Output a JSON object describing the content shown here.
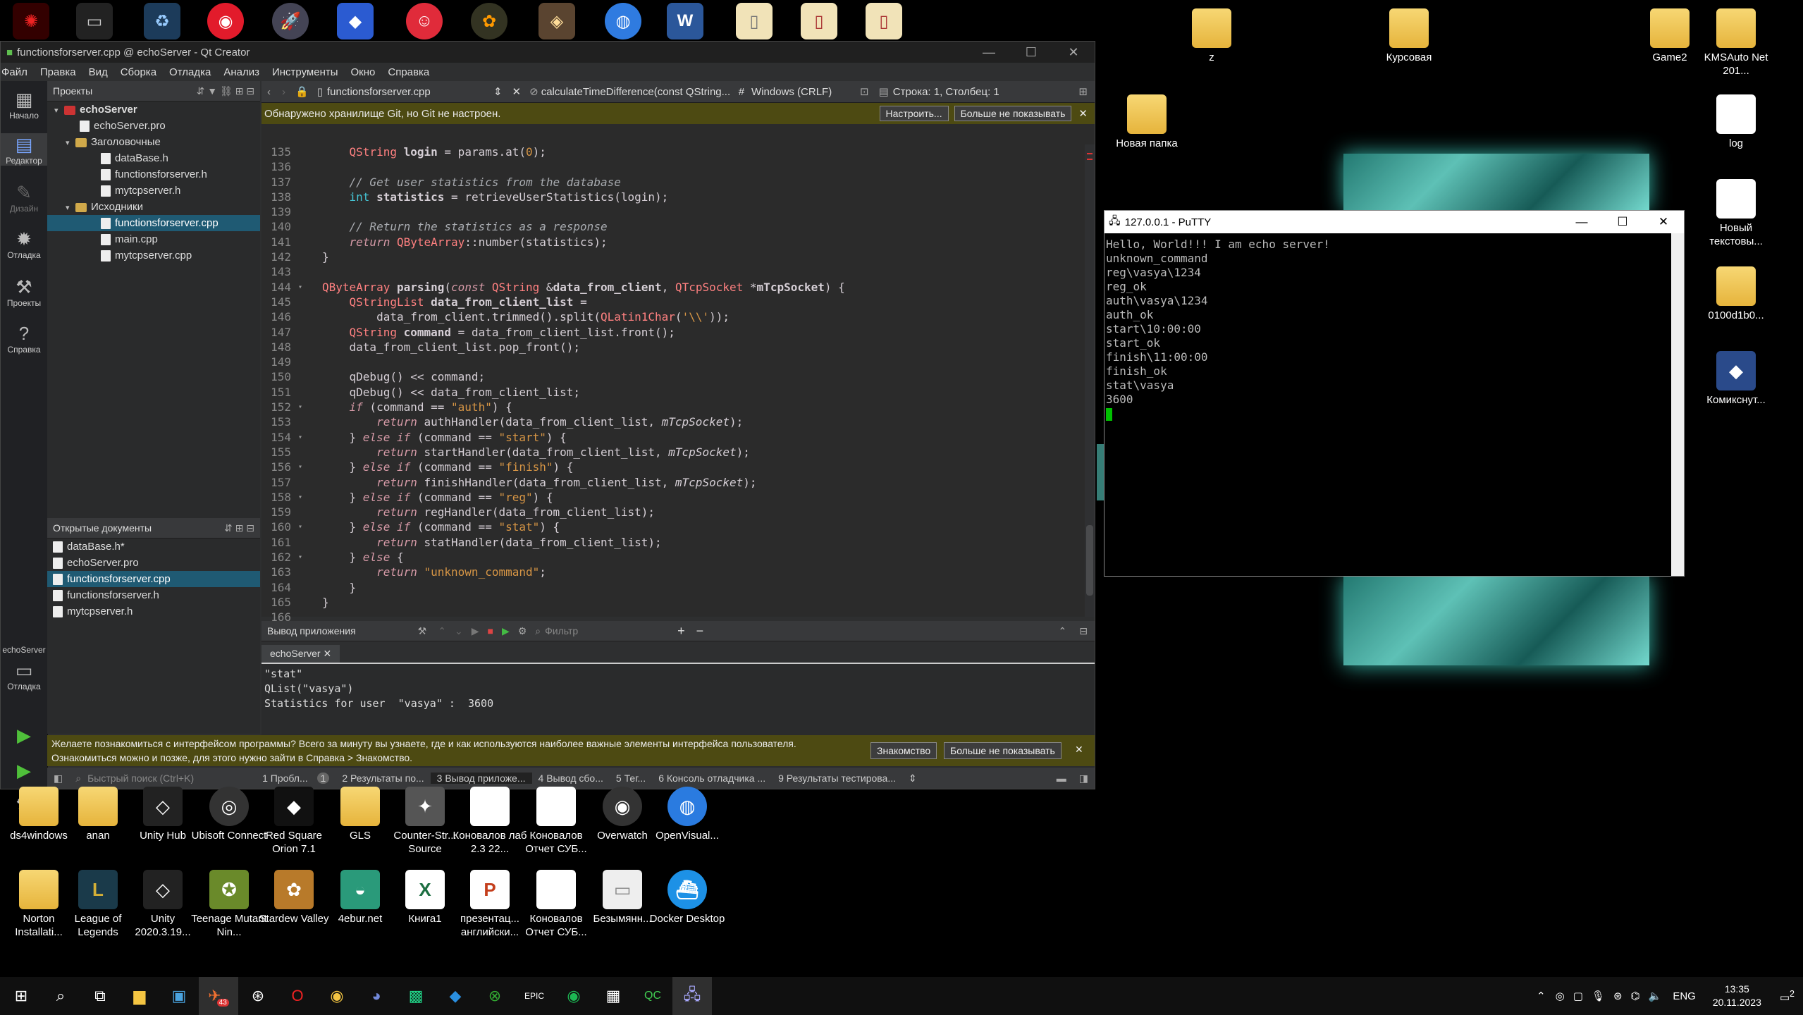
{
  "desktop": {
    "top_icons": [
      "tool-red",
      "tape",
      "recycle",
      "fortnite",
      "rocket",
      "sonic",
      "smile",
      "fl-studio",
      "game",
      "globe",
      "word",
      "file1",
      "file2",
      "file3"
    ],
    "right_icons": [
      {
        "label": "z"
      },
      {
        "label": "Курсовая"
      },
      {
        "label": "Game2"
      },
      {
        "label": "KMSAuto Net 201..."
      },
      {
        "label": "Новая папка"
      },
      {
        "label": "log"
      },
      {
        "label": "Новый текстовы..."
      },
      {
        "label": "0100d1b0..."
      },
      {
        "label": "Комикснут..."
      }
    ],
    "bottom_row1": [
      {
        "label": "ds4windows"
      },
      {
        "label": "anan"
      },
      {
        "label": "Unity Hub"
      },
      {
        "label": "Ubisoft Connect"
      },
      {
        "label": "Red Square Orion 7.1"
      },
      {
        "label": "GLS"
      },
      {
        "label": "Counter-Str... Source"
      },
      {
        "label": "Коновалов лаб 2.3 22..."
      },
      {
        "label": "Коновалов Отчет СУБ..."
      },
      {
        "label": "Overwatch"
      },
      {
        "label": "OpenVisual..."
      }
    ],
    "bottom_row2": [
      {
        "label": "Norton Installati..."
      },
      {
        "label": "League of Legends"
      },
      {
        "label": "Unity 2020.3.19..."
      },
      {
        "label": "Teenage Mutant Nin..."
      },
      {
        "label": "Stardew Valley"
      },
      {
        "label": "4ebur.net"
      },
      {
        "label": "Книга1"
      },
      {
        "label": "презентац... английски..."
      },
      {
        "label": "Коновалов Отчет СУБ..."
      },
      {
        "label": "Безымянн..."
      },
      {
        "label": "Docker Desktop"
      }
    ]
  },
  "qt": {
    "title": "functionsforserver.cpp @ echoServer - Qt Creator",
    "menu": [
      "Файл",
      "Правка",
      "Вид",
      "Сборка",
      "Отладка",
      "Анализ",
      "Инструменты",
      "Окно",
      "Справка"
    ],
    "modes": [
      {
        "label": "Начало"
      },
      {
        "label": "Редактор"
      },
      {
        "label": "Дизайн"
      },
      {
        "label": "Отладка"
      },
      {
        "label": "Проекты"
      },
      {
        "label": "Справка"
      }
    ],
    "kit_label": "echoServer",
    "kit_mode": "Отладка",
    "projects_header": "Проекты",
    "tree": [
      {
        "label": "echoServer",
        "indent": 0,
        "kind": "root"
      },
      {
        "label": "echoServer.pro",
        "indent": 1,
        "kind": "file"
      },
      {
        "label": "Заголовочные",
        "indent": 1,
        "kind": "folder"
      },
      {
        "label": "dataBase.h",
        "indent": 2,
        "kind": "file"
      },
      {
        "label": "functionsforserver.h",
        "indent": 2,
        "kind": "file"
      },
      {
        "label": "mytcpserver.h",
        "indent": 2,
        "kind": "file"
      },
      {
        "label": "Исходники",
        "indent": 1,
        "kind": "folder"
      },
      {
        "label": "functionsforserver.cpp",
        "indent": 2,
        "kind": "file",
        "selected": true
      },
      {
        "label": "main.cpp",
        "indent": 2,
        "kind": "file"
      },
      {
        "label": "mytcpserver.cpp",
        "indent": 2,
        "kind": "file"
      }
    ],
    "open_docs_header": "Открытые документы",
    "open_docs": [
      {
        "label": "dataBase.h*"
      },
      {
        "label": "echoServer.pro"
      },
      {
        "label": "functionsforserver.cpp",
        "selected": true
      },
      {
        "label": "functionsforserver.h"
      },
      {
        "label": "mytcpserver.h"
      }
    ],
    "editor": {
      "file": "functionsforserver.cpp",
      "symbol": "calculateTimeDifference(const QString...",
      "hash": "#",
      "line_ending": "Windows (CRLF)",
      "position": "Строка: 1, Столбец: 1"
    },
    "git_bar": {
      "text": "Обнаружено хранилище Git, но Git не настроен.",
      "configure": "Настроить...",
      "dont_show": "Больше не показывать"
    },
    "line_numbers": [
      "135",
      "136",
      "137",
      "138",
      "139",
      "140",
      "141",
      "142",
      "143",
      "144",
      "145",
      "146",
      "147",
      "148",
      "149",
      "150",
      "151",
      "152",
      "153",
      "154",
      "155",
      "156",
      "157",
      "158",
      "159",
      "160",
      "161",
      "162",
      "163",
      "164",
      "165",
      "166"
    ],
    "output": {
      "header": "Вывод приложения",
      "filter_placeholder": "Фильтр",
      "tab": "echoServer",
      "lines": [
        "\"stat\"",
        "QList(\"vasya\")",
        "Statistics for user  \"vasya\" :  3600"
      ]
    },
    "welcome": {
      "line1": "Желаете познакомиться с интерфейсом программы? Всего за минуту вы узнаете, где и как используются наиболее важные элементы интерфейса пользователя.",
      "line2": "Ознакомиться можно и позже, для этого нужно зайти в Справка > Знакомство.",
      "tour": "Знакомство",
      "dont_show": "Больше не показывать"
    },
    "status": {
      "search_placeholder": "Быстрый поиск (Ctrl+K)",
      "tabs": [
        "1  Пробл...",
        "2  Результаты по...",
        "3  Вывод приложе...",
        "4  Вывод сбо...",
        "5  Тег...",
        "6  Консоль отладчика ...",
        "9  Результаты тестирова..."
      ],
      "problems_badge": "1"
    }
  },
  "putty": {
    "title": "127.0.0.1 - PuTTY",
    "lines": [
      "Hello, World!!! I am echo server!",
      "unknown_command",
      "reg\\vasya\\1234",
      "reg_ok",
      "auth\\vasya\\1234",
      "auth_ok",
      "start\\10:00:00",
      "start_ok",
      "finish\\11:00:00",
      "finish_ok",
      "stat\\vasya",
      "3600"
    ]
  },
  "taskbar": {
    "lang": "ENG",
    "time": "13:35",
    "date": "20.11.2023",
    "notif_count": "2",
    "telegram_badge": "43"
  }
}
